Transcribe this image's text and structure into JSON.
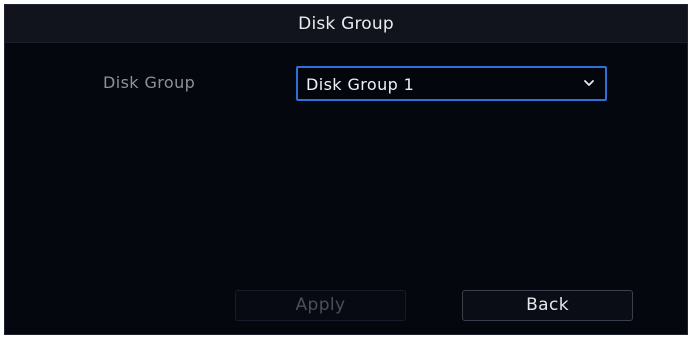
{
  "dialog": {
    "title": "Disk Group"
  },
  "form": {
    "disk_group_label": "Disk Group",
    "disk_group_value": "Disk Group 1"
  },
  "buttons": {
    "apply_label": "Apply",
    "back_label": "Back"
  },
  "icons": {
    "dropdown": "chevron-down-icon"
  },
  "colors": {
    "dialog_background": "#05070f",
    "titlebar_background": "#12141d",
    "select_border_accent": "#2f6fd6"
  }
}
